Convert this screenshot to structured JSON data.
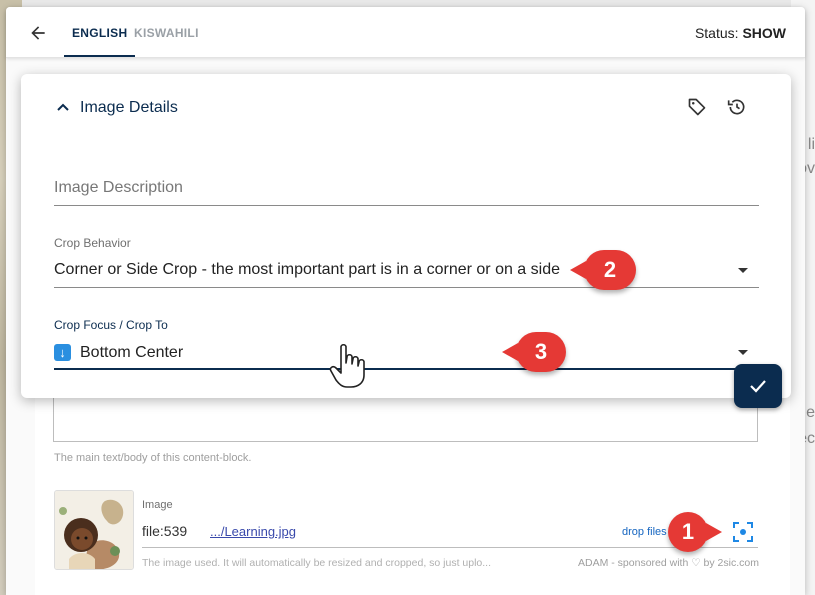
{
  "topbar": {
    "tabs": [
      {
        "label": "ENGLISH",
        "active": true
      },
      {
        "label": "KISWAHILI",
        "active": false
      }
    ],
    "status_label": "Status:",
    "status_value": "SHOW"
  },
  "panel": {
    "title": "Image Details",
    "fields": {
      "description": {
        "placeholder": "Image Description",
        "value": ""
      },
      "crop_behavior": {
        "label": "Crop Behavior",
        "value": "Corner or Side Crop - the most important part is in a corner or on a side"
      },
      "crop_focus": {
        "label": "Crop Focus / Crop To",
        "value": "Bottom Center",
        "icon": "down-arrow-icon"
      }
    }
  },
  "content_block": {
    "body_hint": "The main text/body of this content-block.",
    "image_label": "Image",
    "image_value": "file:539",
    "image_link": ".../Learning.jpg",
    "drop_files": "drop files",
    "image_hint": "The image used. It will automatically be resized and cropped, so just uplo...",
    "adam_note": "ADAM - sponsored with ♡ by 2sic.com"
  },
  "callouts": [
    "1",
    "2",
    "3"
  ],
  "background_right": [
    "li",
    "ov",
    "le",
    "ec"
  ],
  "colors": {
    "primary": "#0b2c4f",
    "callout": "#e53935",
    "link": "#3949ab"
  }
}
